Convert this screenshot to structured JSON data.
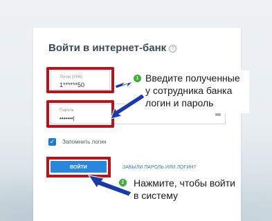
{
  "login_form": {
    "title": "Войти в интернет-банк",
    "info_icon_glyph": "?",
    "login_label": "Логин (УНК)",
    "login_value": "1******50",
    "password_label": "Пароль",
    "password_value": "•••••••|",
    "remember_label": "Запомнить логин",
    "remember_checked": true,
    "submit_label": "ВОЙТИ",
    "forgot_link": "ЗАБЫЛИ ПАРОЛЬ ИЛИ ЛОГИН?"
  },
  "annotations": {
    "step1_number": "1",
    "step1_text": [
      "Введите полученные",
      "у сотрудника банка",
      "логин и пароль"
    ],
    "step2_number": "2",
    "step2_text": [
      "Нажмите, чтобы войти",
      "в систему"
    ],
    "highlight_color": "#b6131c",
    "badge_color": "#3fae35",
    "arrow_color": "#1c3aa6"
  },
  "icons": {
    "checkbox": "check-icon",
    "keyboard": "keyboard-icon",
    "info": "info-icon"
  }
}
